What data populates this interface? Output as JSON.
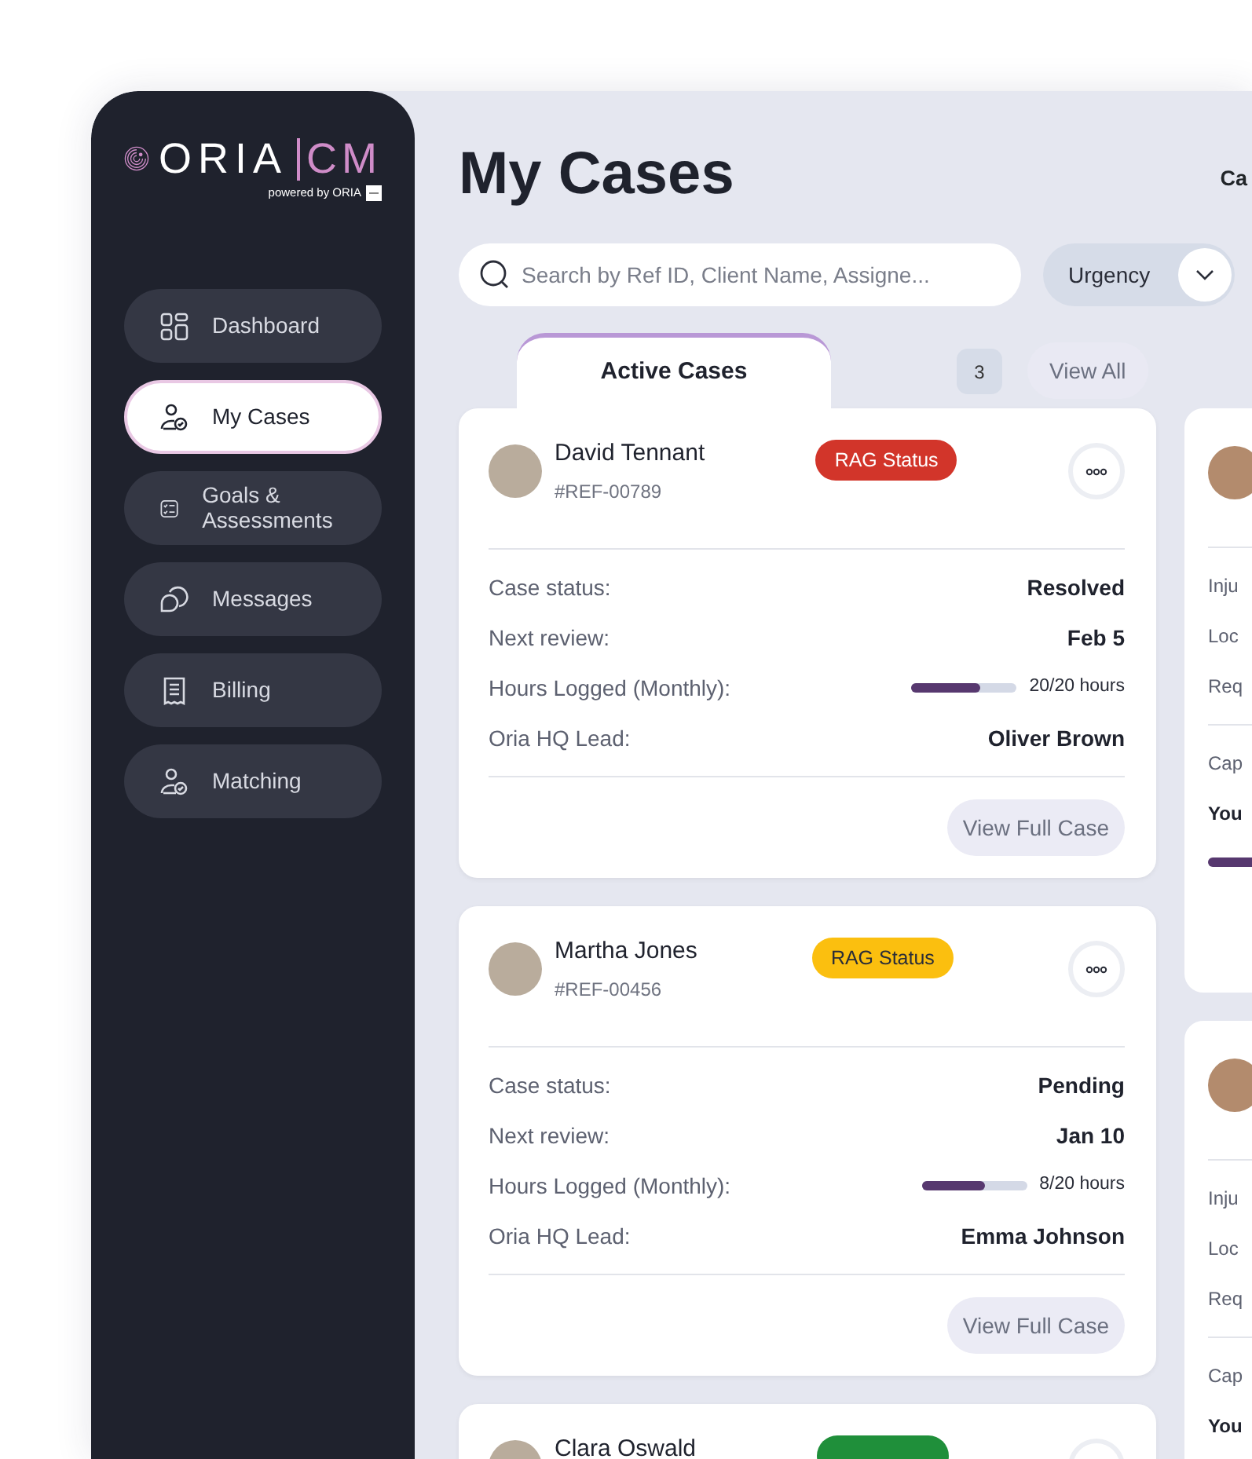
{
  "logo": {
    "name": "ORIA",
    "suffix": "CM",
    "tagline": "powered by ORIA"
  },
  "sidebar": {
    "items": [
      {
        "label": "Dashboard",
        "selected": false
      },
      {
        "label": "My Cases",
        "selected": true
      },
      {
        "label": "Goals & Assessments",
        "selected": false
      },
      {
        "label": "Messages",
        "selected": false
      },
      {
        "label": "Billing",
        "selected": false
      },
      {
        "label": "Matching",
        "selected": false
      }
    ]
  },
  "page_title": "My Cases",
  "header_right": "Ca",
  "search": {
    "placeholder": "Search by Ref ID, Client Name, Assigne..."
  },
  "filter": {
    "label": "Urgency"
  },
  "columns": [
    {
      "tab": {
        "label": "Active Cases",
        "selected": true
      },
      "count": "3",
      "view_all": "View All",
      "cards": [
        {
          "name": "David Tennant",
          "ref": "#REF-00789",
          "rag": {
            "label": "RAG Status",
            "color": "#d2352a"
          },
          "fields": [
            {
              "kind": "text",
              "label": "Case status:",
              "value": "Resolved"
            },
            {
              "kind": "text",
              "label": "Next review:",
              "value": "Feb 5"
            },
            {
              "kind": "progress",
              "label": "Hours Logged (Monthly):",
              "level": 0.66,
              "reading": "20/20 hours"
            },
            {
              "kind": "text",
              "label": "Oria HQ Lead:",
              "value": "Oliver Brown"
            }
          ],
          "action": "View Full Case"
        },
        {
          "name": "Martha Jones",
          "ref": "#REF-00456",
          "rag": {
            "label": "RAG Status",
            "color": "#fbbf0f"
          },
          "fields": [
            {
              "kind": "text",
              "label": "Case status:",
              "value": "Pending"
            },
            {
              "kind": "text",
              "label": "Next review:",
              "value": "Jan 10"
            },
            {
              "kind": "progress",
              "label": "Hours Logged (Monthly):",
              "level": 0.6,
              "reading": "8/20 hours"
            },
            {
              "kind": "text",
              "label": "Oria HQ Lead:",
              "value": "Emma Johnson"
            }
          ],
          "action": "View Full Case"
        },
        {
          "name": "Clara Oswald",
          "rag": {
            "color": "#1f8f3a"
          }
        }
      ]
    },
    {
      "cards": [
        {
          "rows": [
            "Inju",
            "Loc",
            "Req"
          ],
          "rows2": [
            {
              "label": "Cap",
              "bold": false
            },
            {
              "label": "You",
              "bold": true
            }
          ],
          "bar": true
        },
        {
          "rows": [
            "Inju",
            "Loc",
            "Req"
          ],
          "rows2": [
            {
              "label": "Cap",
              "bold": false
            },
            {
              "label": "You",
              "bold": true
            }
          ],
          "bar": false
        }
      ]
    }
  ]
}
